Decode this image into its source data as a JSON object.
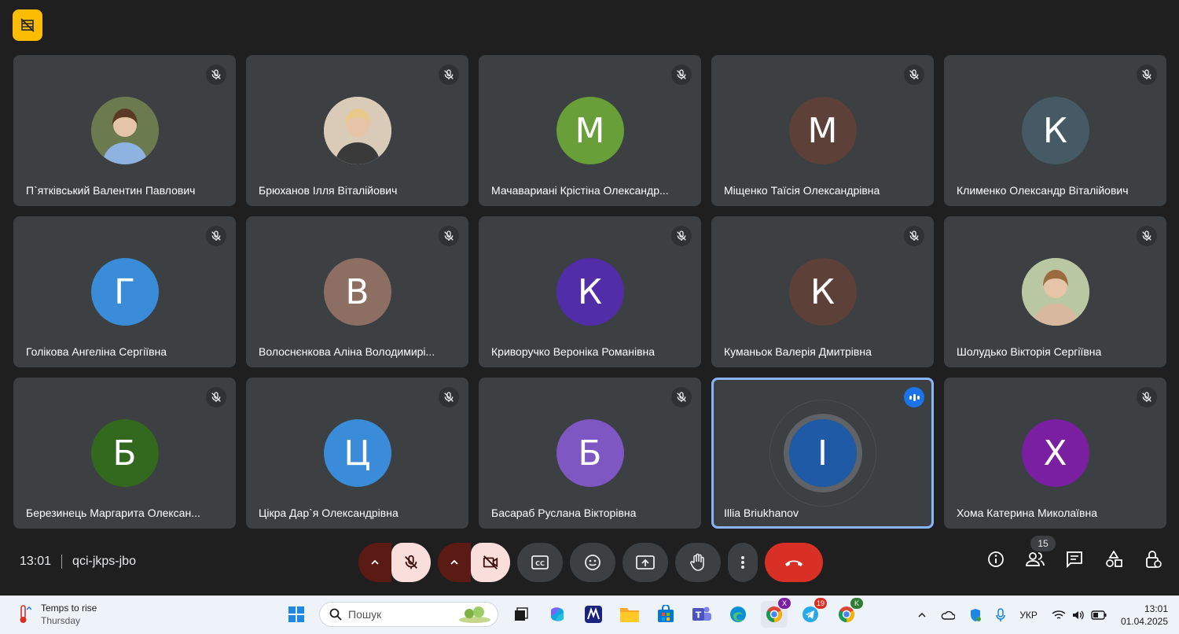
{
  "meeting": {
    "time": "13:01",
    "code": "qci-jkps-jbo",
    "participant_count": "15"
  },
  "participants": [
    {
      "name": "П`ятківський Валентин Павлович",
      "initial": "",
      "avatar_color": "#6b7a4f",
      "photo": true,
      "muted": true
    },
    {
      "name": "Брюханов Ілля Віталійович",
      "initial": "",
      "avatar_color": "#d9cbb8",
      "photo": true,
      "muted": true
    },
    {
      "name": "Мачавариані Крістіна Олександр...",
      "initial": "М",
      "avatar_color": "#689f38",
      "photo": false,
      "muted": true
    },
    {
      "name": "Міщенко Таїсія Олександрівна",
      "initial": "М",
      "avatar_color": "#5d4037",
      "photo": false,
      "muted": true
    },
    {
      "name": "Клименко Олександр Віталійович",
      "initial": "К",
      "avatar_color": "#455a64",
      "photo": false,
      "muted": true
    },
    {
      "name": "Голікова Ангеліна Сергіївна",
      "initial": "Г",
      "avatar_color": "#3a8bd8",
      "photo": false,
      "muted": true
    },
    {
      "name": "Волоснєнкова Аліна Володимирі...",
      "initial": "В",
      "avatar_color": "#8d6e63",
      "photo": false,
      "muted": true
    },
    {
      "name": "Криворучко Вероніка Романівна",
      "initial": "К",
      "avatar_color": "#512da8",
      "photo": false,
      "muted": true
    },
    {
      "name": "Куманьок Валерія Дмитрівна",
      "initial": "К",
      "avatar_color": "#5d4037",
      "photo": false,
      "muted": true
    },
    {
      "name": "Шолудько Вікторія Сергіївна",
      "initial": "",
      "avatar_color": "#b9c7a3",
      "photo": true,
      "muted": true
    },
    {
      "name": "Березинець Маргарита Олексан...",
      "initial": "Б",
      "avatar_color": "#33691e",
      "photo": false,
      "muted": true
    },
    {
      "name": "Цікра Дар`я Олександрівна",
      "initial": "Ц",
      "avatar_color": "#3a8bd8",
      "photo": false,
      "muted": true
    },
    {
      "name": "Басараб Руслана Вікторівна",
      "initial": "Б",
      "avatar_color": "#7e57c2",
      "photo": false,
      "muted": true
    },
    {
      "name": "Illia Briukhanov",
      "initial": "I",
      "avatar_color": "#1f5aa6",
      "photo": false,
      "muted": false,
      "speaking": true
    },
    {
      "name": "Хома Катерина Миколаївна",
      "initial": "Х",
      "avatar_color": "#7b1fa2",
      "photo": false,
      "muted": true
    }
  ],
  "controls": {
    "icons": [
      "chevron-up-icon",
      "mic-off-icon",
      "chevron-up-icon",
      "camera-off-icon",
      "captions-icon",
      "emoji-icon",
      "present-icon",
      "raise-hand-icon",
      "more-icon",
      "end-call-icon"
    ]
  },
  "right_icons": [
    "info-icon",
    "people-icon",
    "chat-icon",
    "activities-icon",
    "host-controls-icon"
  ],
  "taskbar": {
    "weather_title": "Temps to rise",
    "weather_day": "Thursday",
    "search_placeholder": "Пошук",
    "telegram_badge": "19",
    "chrome_badge_1": "X",
    "chrome_badge_2": "K",
    "language": "УКР",
    "clock_time": "13:01",
    "clock_date": "01.04.2025"
  },
  "colors": {
    "meet_bg": "#1f1f1f",
    "tile_bg": "#3c4043",
    "active_outline": "#8ab4f8",
    "end_call": "#d93025",
    "muted_control": "#f9dedc",
    "badge_yellow": "#fbbc04"
  }
}
